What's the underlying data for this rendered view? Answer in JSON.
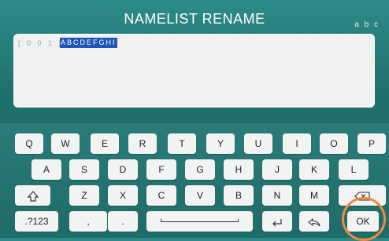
{
  "header": {
    "title": "NAMELIST RENAME",
    "mode_label": "a b c"
  },
  "editor": {
    "prefix": "[ 0 0 1 ]",
    "selected_text": "ABCDEFGHI"
  },
  "keyboard": {
    "row1": [
      "Q",
      "W",
      "E",
      "R",
      "T",
      "Y",
      "U",
      "I",
      "O",
      "P"
    ],
    "row2": [
      "A",
      "S",
      "D",
      "F",
      "G",
      "H",
      "J",
      "K",
      "L"
    ],
    "row3": [
      "Z",
      "X",
      "C",
      "V",
      "B",
      "N",
      "M"
    ],
    "numeric_label": ".?123",
    "comma_label": ",",
    "period_label": ".",
    "ok_label": "OK",
    "icons": {
      "shift": "shift-icon",
      "backspace": "backspace-icon",
      "space": "space-icon",
      "enter": "enter-icon",
      "undo": "undo-icon"
    }
  },
  "colors": {
    "accent_ring": "#f08a3c",
    "selection": "#1e56b8"
  }
}
